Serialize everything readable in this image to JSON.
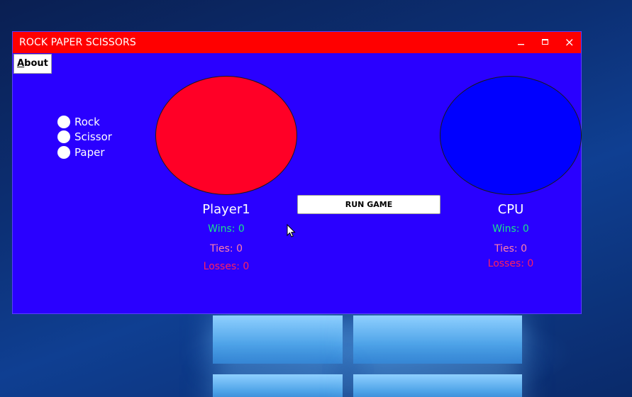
{
  "window": {
    "title": "ROCK PAPER SCISSORS",
    "colors": {
      "titlebar": "#ff0000",
      "background": "#2a00ff",
      "player_circle": "#ff0026",
      "cpu_circle": "#0000ff"
    }
  },
  "titlebar_controls": {
    "minimize_icon": "minimize-icon",
    "maximize_icon": "maximize-icon",
    "close_icon": "close-icon"
  },
  "menu": {
    "about_first": "A",
    "about_rest": "bout"
  },
  "choices": {
    "options": [
      "Rock",
      "Scissor",
      "Paper"
    ]
  },
  "run_button": {
    "label": "RUN GAME"
  },
  "player": {
    "name": "Player1",
    "wins": "Wins: 0",
    "ties": "Ties: 0",
    "losses": "Losses: 0"
  },
  "cpu": {
    "name": "CPU",
    "wins": "Wins: 0",
    "ties": "Ties: 0",
    "losses": "Losses: 0"
  }
}
